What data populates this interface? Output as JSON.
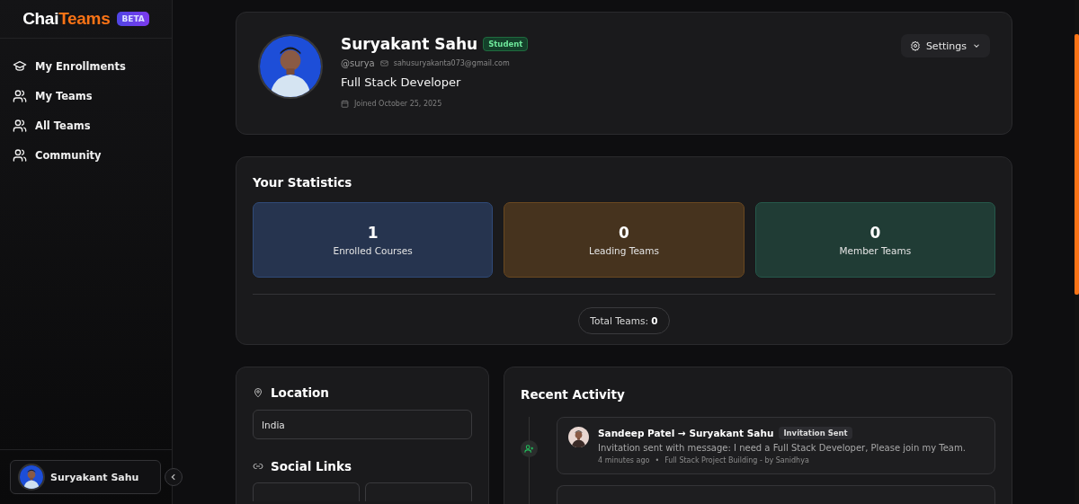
{
  "sidebar": {
    "logo": {
      "first": "Chai",
      "second": "Teams",
      "badge": "BETA"
    },
    "items": [
      {
        "label": "My Enrollments",
        "kind": "graduation"
      },
      {
        "label": "My Teams",
        "kind": "users"
      },
      {
        "label": "All Teams",
        "kind": "users"
      },
      {
        "label": "Community",
        "kind": "users"
      }
    ],
    "user": {
      "name": "Suryakant Sahu"
    }
  },
  "profile": {
    "name": "Suryakant Sahu",
    "role_badge": "Student",
    "handle": "@surya",
    "email": "sahusuryakanta073@gmail.com",
    "headline": "Full Stack Developer",
    "joined": "Joined October 25, 2025",
    "settings_button": "Settings"
  },
  "statistics": {
    "title": "Your Statistics",
    "tiles": [
      {
        "value": "1",
        "label": "Enrolled Courses",
        "color": "#2f4a78"
      },
      {
        "value": "0",
        "label": "Leading Teams",
        "color": "#6a4820"
      },
      {
        "value": "0",
        "label": "Member Teams",
        "color": "#25584a"
      }
    ],
    "total_label": "Total Teams:",
    "total_value": "0"
  },
  "location": {
    "title": "Location",
    "value": "India"
  },
  "social_links": {
    "title": "Social Links"
  },
  "recent_activity": {
    "title": "Recent Activity",
    "items": [
      {
        "actor": "Sandeep Patel → Suryakant Sahu",
        "tag": "Invitation Sent",
        "message": "Invitation sent with message: I need a Full Stack Developer, Please join my Team.",
        "time": "4 minutes ago",
        "separator": "•",
        "context": "Full Stack Project Building - by Sanidhya"
      }
    ]
  }
}
